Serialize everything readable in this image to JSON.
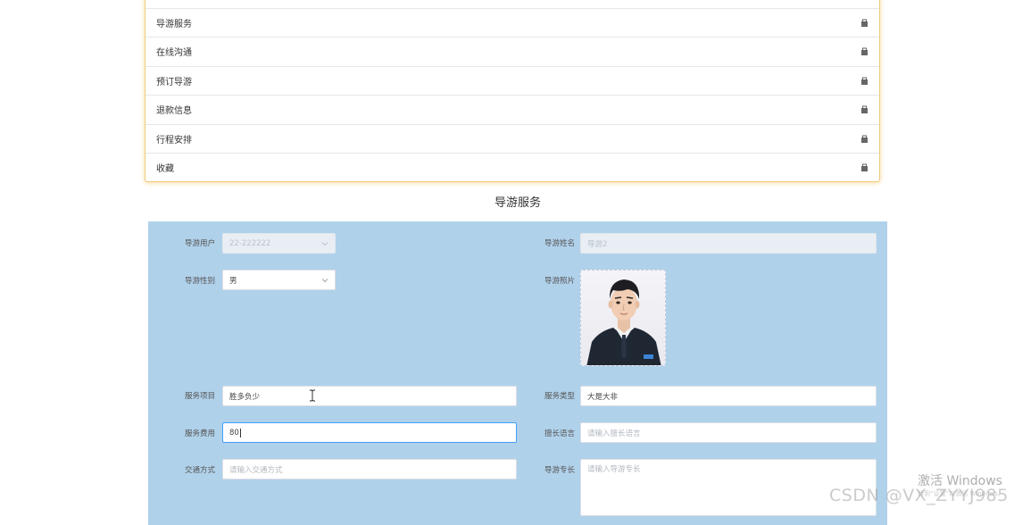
{
  "menu": {
    "items": [
      {
        "label": "导游服务",
        "icon": "bag-icon"
      },
      {
        "label": "在线沟通",
        "icon": "bag-icon"
      },
      {
        "label": "预订导游",
        "icon": "bag-icon"
      },
      {
        "label": "退款信息",
        "icon": "bag-icon"
      },
      {
        "label": "行程安排",
        "icon": "bag-icon"
      },
      {
        "label": "收藏",
        "icon": "bag-icon"
      }
    ]
  },
  "section": {
    "title": "导游服务"
  },
  "form": {
    "guide_user": {
      "label": "导游用户",
      "value": "22-222222"
    },
    "guide_name": {
      "label": "导游姓名",
      "value": "导游2"
    },
    "guide_gender": {
      "label": "导游性别",
      "value": "男"
    },
    "guide_photo": {
      "label": "导游照片"
    },
    "service_item": {
      "label": "服务项目",
      "value": "胜多负少"
    },
    "service_type": {
      "label": "服务类型",
      "value": "大是大非"
    },
    "service_fee": {
      "label": "服务费用",
      "value": "80"
    },
    "language": {
      "label": "擅长语言",
      "placeholder": "请输入擅长语言"
    },
    "transport": {
      "label": "交通方式",
      "placeholder": "请输入交通方式"
    },
    "specialty": {
      "label": "导游专长",
      "placeholder": "请输入导游专长"
    }
  },
  "watermarks": {
    "windows_title": "激活 Windows",
    "windows_sub": "转到“设置”以激活 Windows。",
    "csdn": "CSDN @VX_ZYYJ985"
  },
  "colors": {
    "form_background": "#b0d1ea",
    "menu_border": "#f2c97b",
    "focus_border": "#409eff"
  }
}
